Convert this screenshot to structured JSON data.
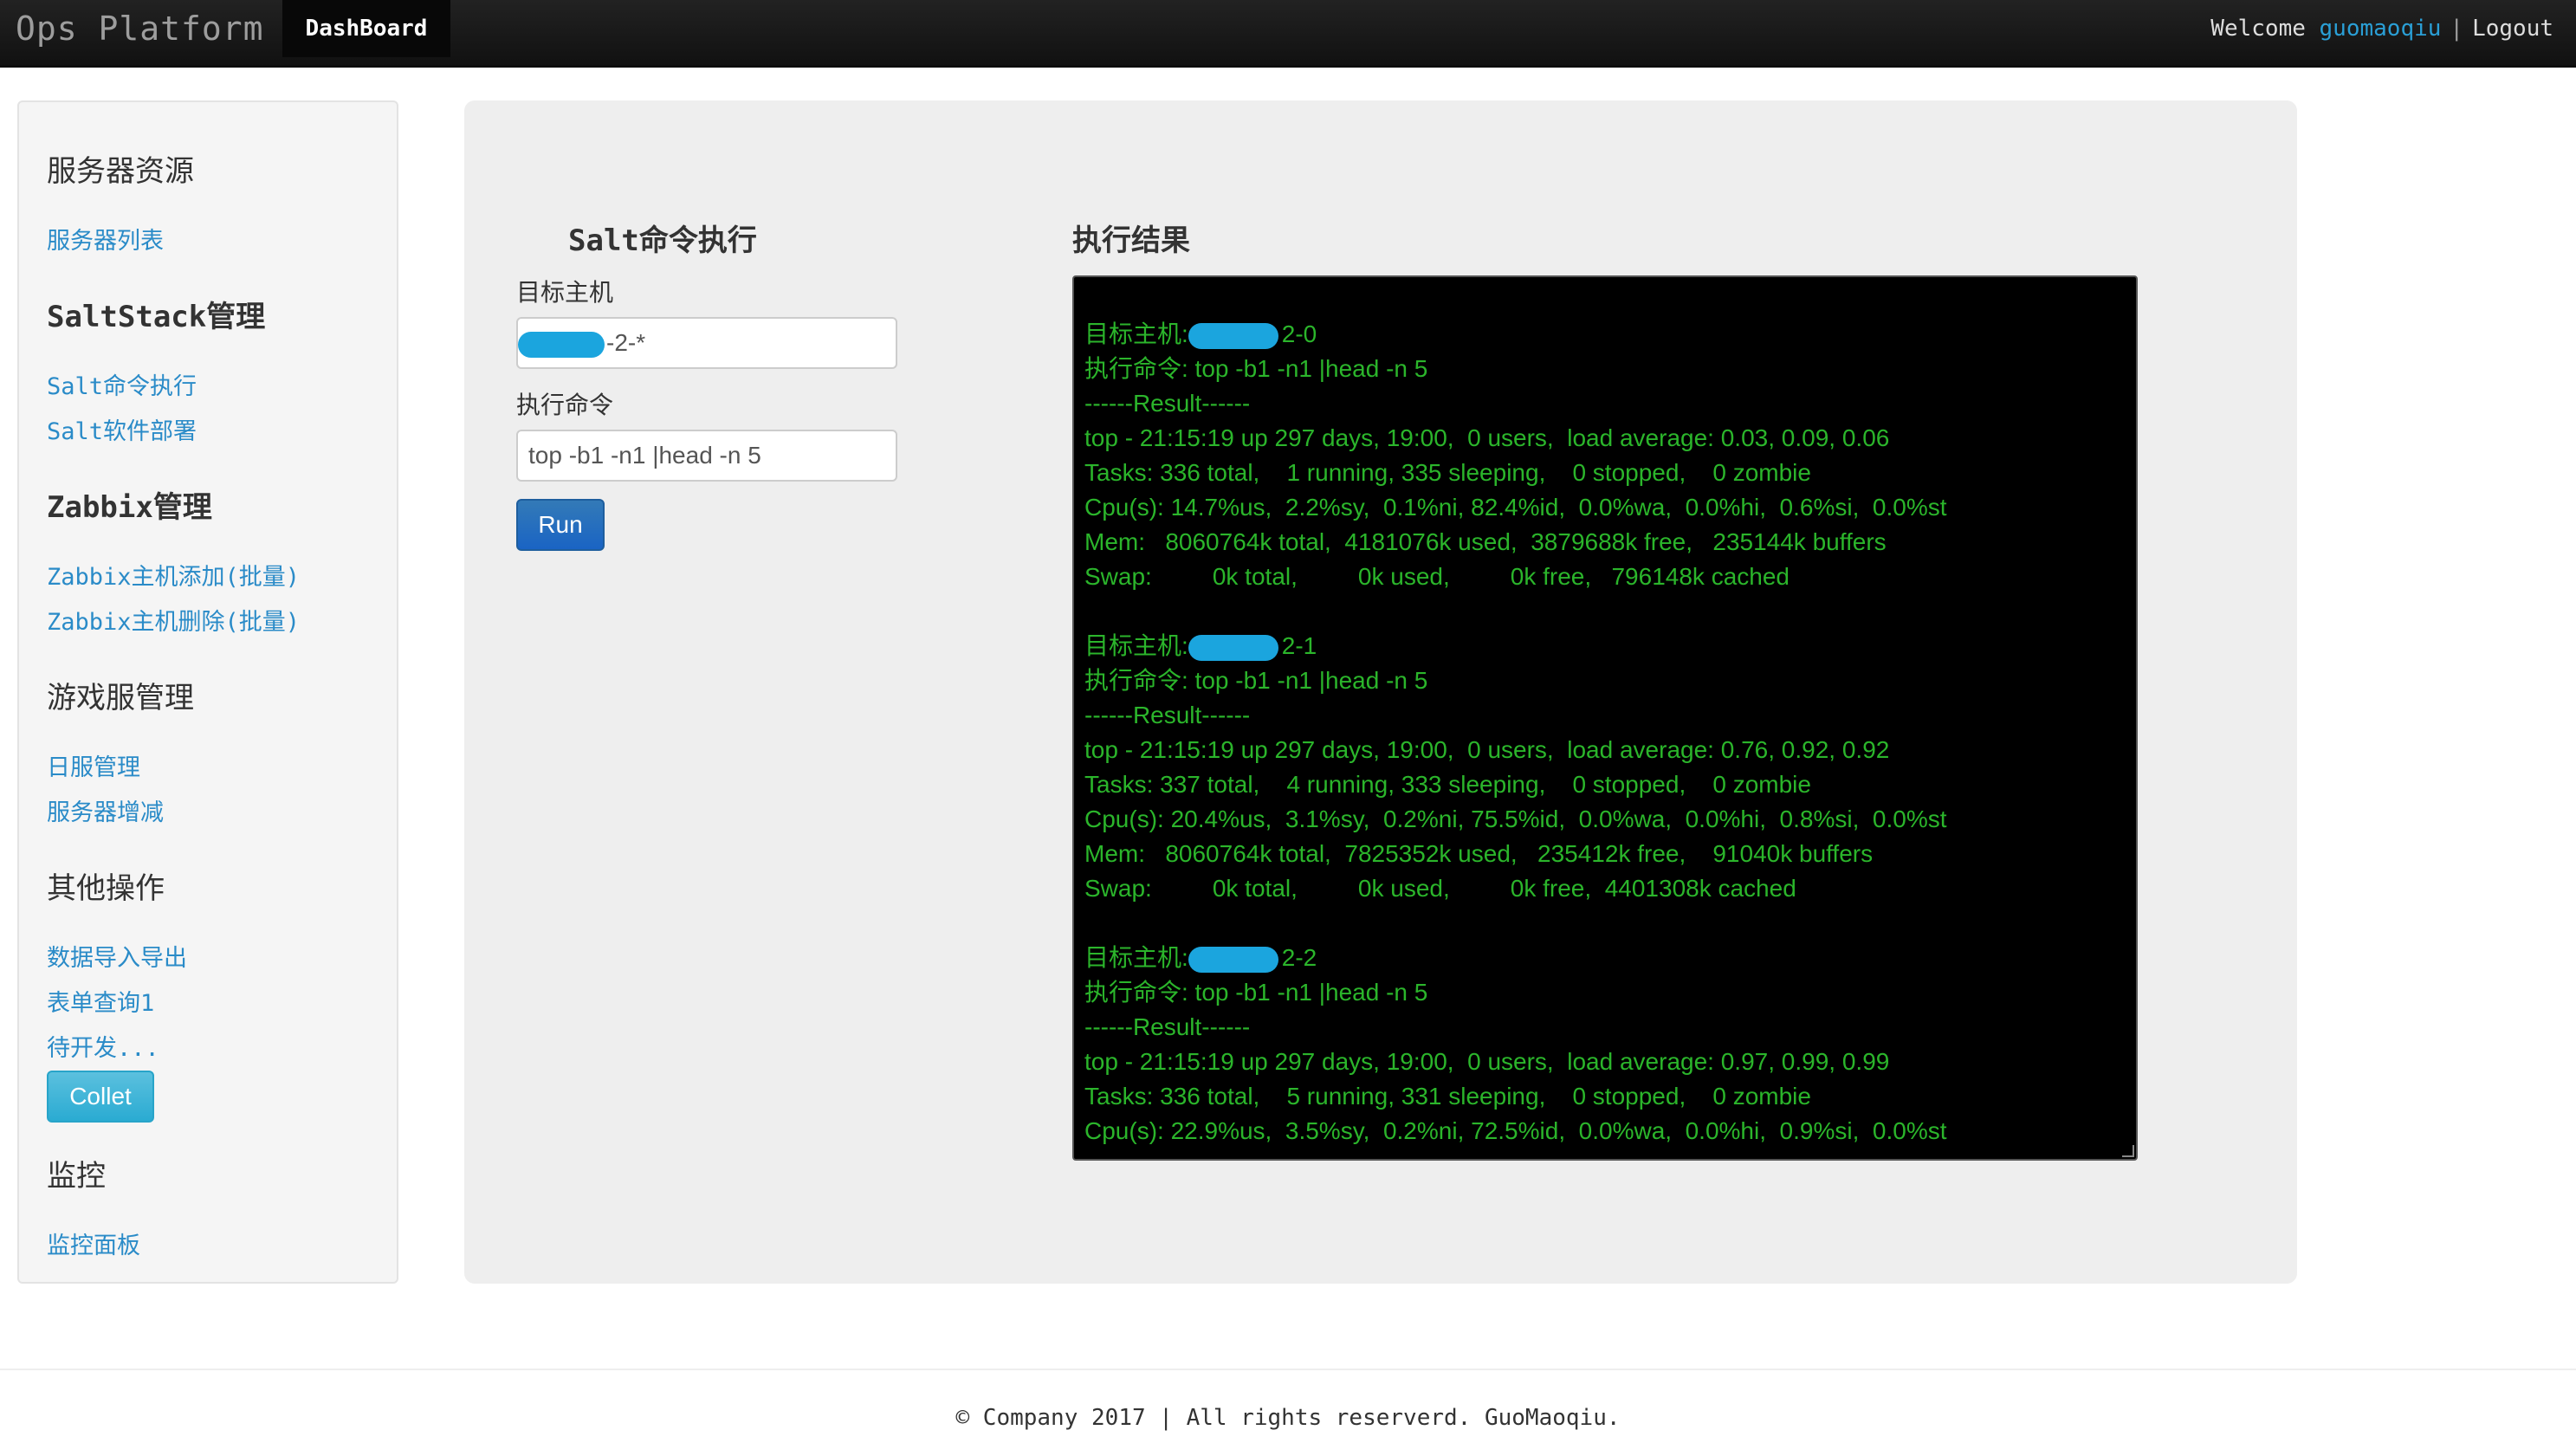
{
  "navbar": {
    "brand": "Ops Platform",
    "active_tab": "DashBoard",
    "welcome": "Welcome",
    "username": "guomaoqiu",
    "separator": "|",
    "logout": "Logout"
  },
  "sidebar": {
    "sections": [
      {
        "title": "服务器资源",
        "links": [
          "服务器列表"
        ]
      },
      {
        "title": "SaltStack管理",
        "links": [
          "Salt命令执行",
          "Salt软件部署"
        ]
      },
      {
        "title": "Zabbix管理",
        "links": [
          "Zabbix主机添加(批量)",
          "Zabbix主机删除(批量)"
        ]
      },
      {
        "title": "游戏服管理",
        "links": [
          "日服管理",
          "服务器增减"
        ]
      },
      {
        "title": "其他操作",
        "links": [
          "数据导入导出",
          "表单查询1",
          "待开发..."
        ]
      },
      {
        "title": "监控",
        "links": [
          "监控面板"
        ]
      }
    ],
    "collet_button": "Collet"
  },
  "form": {
    "title": "Salt命令执行",
    "target_label": "目标主机",
    "target_suffix": "-2-*",
    "command_label": "执行命令",
    "command_value": "top -b1 -n1 |head -n 5",
    "run_button": "Run"
  },
  "result": {
    "title": "执行结果",
    "blocks": [
      {
        "host_label": "目标主机:",
        "host_suffix": "2-0",
        "command": "执行命令: top -b1 -n1 |head -n 5",
        "result_header": "------Result------",
        "lines": [
          "top - 21:15:19 up 297 days, 19:00,  0 users,  load average: 0.03, 0.09, 0.06",
          "Tasks: 336 total,    1 running, 335 sleeping,    0 stopped,    0 zombie",
          "Cpu(s): 14.7%us,  2.2%sy,  0.1%ni, 82.4%id,  0.0%wa,  0.0%hi,  0.6%si,  0.0%st",
          "Mem:   8060764k total,  4181076k used,  3879688k free,   235144k buffers",
          "Swap:         0k total,         0k used,         0k free,   796148k cached"
        ]
      },
      {
        "host_label": "目标主机:",
        "host_suffix": "2-1",
        "command": "执行命令: top -b1 -n1 |head -n 5",
        "result_header": "------Result------",
        "lines": [
          "top - 21:15:19 up 297 days, 19:00,  0 users,  load average: 0.76, 0.92, 0.92",
          "Tasks: 337 total,    4 running, 333 sleeping,    0 stopped,    0 zombie",
          "Cpu(s): 20.4%us,  3.1%sy,  0.2%ni, 75.5%id,  0.0%wa,  0.0%hi,  0.8%si,  0.0%st",
          "Mem:   8060764k total,  7825352k used,   235412k free,    91040k buffers",
          "Swap:         0k total,         0k used,         0k free,  4401308k cached"
        ]
      },
      {
        "host_label": "目标主机:",
        "host_suffix": "2-2",
        "command": "执行命令: top -b1 -n1 |head -n 5",
        "result_header": "------Result------",
        "lines": [
          "top - 21:15:19 up 297 days, 19:00,  0 users,  load average: 0.97, 0.99, 0.99",
          "Tasks: 336 total,    5 running, 331 sleeping,    0 stopped,    0 zombie",
          "Cpu(s): 22.9%us,  3.5%sy,  0.2%ni, 72.5%id,  0.0%wa,  0.0%hi,  0.9%si,  0.0%st"
        ]
      }
    ]
  },
  "footer": {
    "text": "© Company 2017 | All rights reserverd. GuoMaoqiu."
  },
  "colors": {
    "navbar_bg": "#1b1b1b",
    "link": "#2a8bc8",
    "terminal_text": "#2bb52b",
    "mask": "#1ba5de",
    "run_button": "#1a64c4",
    "collet_button": "#2aabd2"
  }
}
